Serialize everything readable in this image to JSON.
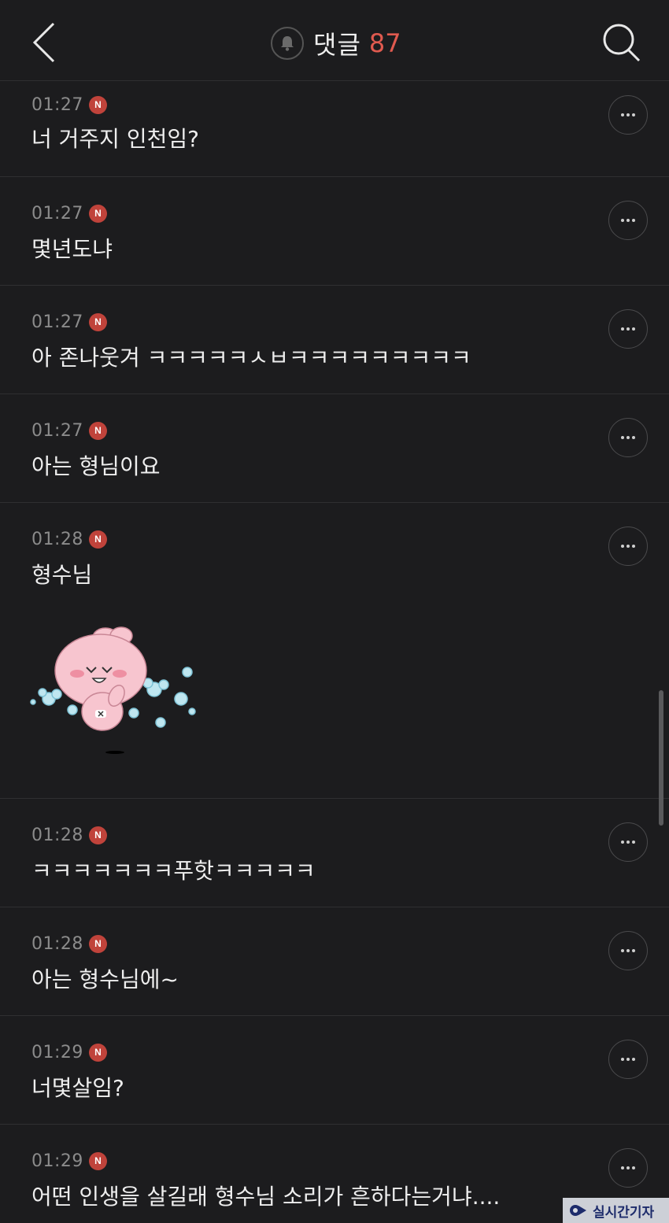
{
  "header": {
    "title": "댓글",
    "count": "87"
  },
  "comments": [
    {
      "time": "01:27",
      "badge": "N",
      "text": "너 거주지 인천임?"
    },
    {
      "time": "01:27",
      "badge": "N",
      "text": "몇년도냐"
    },
    {
      "time": "01:27",
      "badge": "N",
      "text": "아 존나웃겨 ㅋㅋㅋㅋㅋㅅㅂㅋㅋㅋㅋㅋㅋㅋㅋㅋ"
    },
    {
      "time": "01:27",
      "badge": "N",
      "text": "아는 형님이요"
    },
    {
      "time": "01:28",
      "badge": "N",
      "text": "형수님"
    },
    {
      "time": "01:28",
      "badge": "N",
      "text": "ㅋㅋㅋㅋㅋㅋㅋ푸핫ㅋㅋㅋㅋㅋ"
    },
    {
      "time": "01:28",
      "badge": "N",
      "text": "아는 형수님에~"
    },
    {
      "time": "01:29",
      "badge": "N",
      "text": "너몇살임?"
    },
    {
      "time": "01:29",
      "badge": "N",
      "text": "어떤 인생을 살길래 형수님 소리가 흔하다는거냐...."
    }
  ],
  "watermark": {
    "text": "실시간기자"
  },
  "colors": {
    "background": "#1c1c1e",
    "accent": "#e05a4f",
    "badge": "#c0433b"
  }
}
